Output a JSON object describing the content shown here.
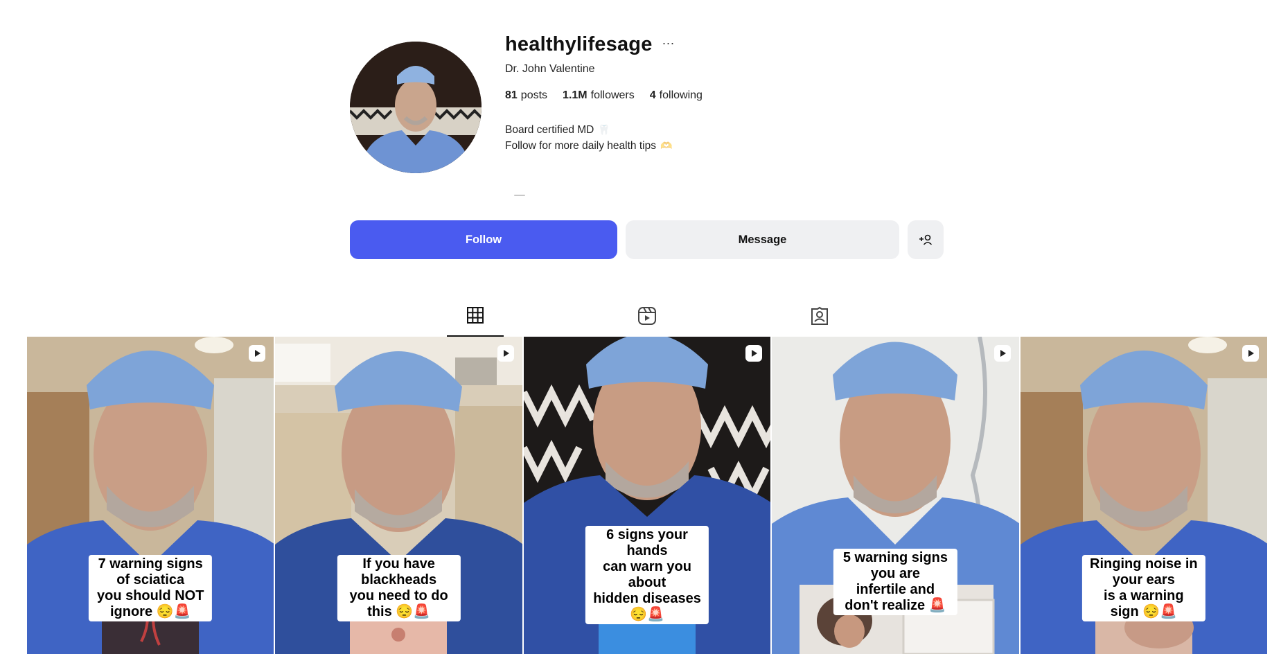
{
  "profile": {
    "username": "healthylifesage",
    "more_label": "···",
    "full_name": "Dr. John Valentine",
    "stats": {
      "posts_count": "81",
      "posts_label": "posts",
      "followers_count": "1.1M",
      "followers_label": "followers",
      "following_count": "4",
      "following_label": "following"
    },
    "bio_line1": "Board certified MD",
    "bio_line2": "Follow for more daily health tips"
  },
  "actions": {
    "follow_label": "Follow",
    "message_label": "Message",
    "add_user_label": "+👤"
  },
  "tabs": [
    {
      "icon": "grid-icon",
      "active": true
    },
    {
      "icon": "reels-icon",
      "active": false
    },
    {
      "icon": "tagged-icon",
      "active": false
    }
  ],
  "posts": [
    {
      "caption": "7 warning signs of sciatica\nyou should NOT ignore 😔🚨"
    },
    {
      "caption": "If you have blackheads\nyou need to do this 😔🚨"
    },
    {
      "caption": "6 signs your hands\ncan warn you about\nhidden diseases 😔🚨"
    },
    {
      "caption": "5 warning signs you are\ninfertile and don't realize 🚨"
    },
    {
      "caption": "Ringing noise in your ears\nis a warning sign 😔🚨"
    }
  ],
  "colors": {
    "accent": "#4a5bf0",
    "button_gray": "#eff0f2",
    "scrubs": "#3f64c4",
    "cap": "#7ea4d8"
  }
}
